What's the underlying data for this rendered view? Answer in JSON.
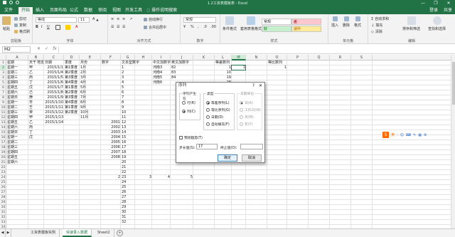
{
  "window": {
    "title": "1.2工资表模板表 - Excel",
    "controls": [
      "—",
      "❐",
      "✕"
    ]
  },
  "ribbon_tabs": [
    "文件",
    "开始",
    "插入",
    "页面布局",
    "公式",
    "数据",
    "审阅",
    "视图",
    "开发工具",
    "帮助"
  ],
  "active_tab": "开始",
  "tell_me": "操作说明搜索",
  "ribbon_right": [
    "登录",
    "共享"
  ],
  "ribbon": {
    "clipboard": {
      "label": "剪贴板",
      "paste": "粘贴",
      "cut": "剪切",
      "copy": "复制",
      "format_painter": "格式刷"
    },
    "font": {
      "label": "字体",
      "family": "等线",
      "size": "11",
      "bold": "B",
      "italic": "I",
      "underline": "U"
    },
    "alignment": {
      "label": "对齐方式",
      "wrap": "自动换行",
      "merge": "合并后居中"
    },
    "number": {
      "label": "数字",
      "format": "常规",
      "percent": "%"
    },
    "styles": {
      "label": "样式",
      "conditional": "条件格式",
      "table": "套用表格格式",
      "normal": "常规",
      "bad": "差",
      "good": "好",
      "neutral": "适中"
    },
    "cells": {
      "label": "单元格",
      "insert": "插入",
      "delete": "删除",
      "format": "格式"
    },
    "editing": {
      "label": "编辑",
      "autosum": "自动求和",
      "fill": "填充",
      "clear": "清除",
      "sort": "排序和筛选",
      "find": "查找和选择"
    }
  },
  "formula_bar": {
    "name_box": "M2",
    "icons": [
      "✕",
      "✓",
      "fx"
    ],
    "content": ""
  },
  "columns": [
    "A",
    "B",
    "C",
    "D",
    "E",
    "F",
    "G",
    "H",
    "I",
    "J",
    "K",
    "L",
    "M",
    "N",
    "O",
    "P",
    "Q",
    "R",
    "S"
  ],
  "selected_column": "M",
  "rows": [
    "1",
    "2",
    "3",
    "4",
    "5",
    "6",
    "7",
    "8",
    "9",
    "10",
    "11",
    "12",
    "13",
    "14",
    "15",
    "16",
    "17",
    "18",
    "19",
    "20",
    "21",
    "22",
    "23",
    "24",
    "25",
    "26",
    "27",
    "28",
    "29",
    "30",
    "31",
    "32",
    "33",
    "34"
  ],
  "selected_row": "2",
  "headers_row1": {
    "A": "星期",
    "B": "天干",
    "B2": "地支",
    "C": "日期",
    "D": "季度",
    "E": "月份",
    "F": "数字",
    "G": "文本型数字",
    "I": "中文加数字",
    "J": "英文加数字",
    "L": "等差数列",
    "O": "等比数列"
  },
  "col_a": [
    "星期一",
    "星期二",
    "星期三",
    "星期四",
    "星期五",
    "星期六",
    "星期日",
    "星期一",
    "星期二",
    "星期三",
    "星期四",
    "星期五",
    "星期六",
    "星期日",
    "星期一",
    "星期二",
    "星期三",
    "星期四",
    "星期五",
    "星期六"
  ],
  "col_b": [
    "甲",
    "乙",
    "丙",
    "丁",
    "戊",
    "己",
    "庚",
    "辛",
    "壬",
    "癸",
    "甲",
    "乙",
    "丙",
    "丁",
    "戊"
  ],
  "col_c": [
    "2015/1/1",
    "2015/1/4",
    "2015/1/5",
    "2015/1/6",
    "2015/1/7",
    "2015/1/8",
    "2015/1/9",
    "2015/1/10",
    "2015/1/11",
    "2015/1/12",
    "2015/1/13",
    "2015/1/14"
  ],
  "col_d": [
    "第1季度",
    "第2季度",
    "第3季度",
    "第4季度",
    "第1季度",
    "第2季度",
    "第3季度",
    "第4季度",
    "第1季度",
    "第2季度"
  ],
  "col_e": [
    "1月",
    "2月",
    "3月",
    "4月",
    "5月",
    "6月",
    "7月",
    "8月",
    "9月",
    "10月",
    "11月"
  ],
  "col_g": [
    "1",
    "2",
    "3",
    "4",
    "5",
    "6",
    "7",
    "8",
    "9",
    "10",
    "11",
    "12",
    "13",
    "14",
    "15",
    "16",
    "17",
    "18",
    "19",
    "20",
    "21",
    "22",
    "23",
    "24",
    "25",
    "26",
    "27",
    "28",
    "29",
    "30",
    "31",
    "32"
  ],
  "col_g_extra": [
    "2001",
    "2002",
    "2003",
    "2004",
    "2005",
    "2006",
    "2007",
    "2008"
  ],
  "col_i": [
    "河南3",
    "河南4",
    "河南5",
    "河南6"
  ],
  "col_j": [
    "82",
    "83",
    "84"
  ],
  "col_l": [
    "1",
    "10",
    "19",
    "28",
    "37",
    "46",
    "55",
    "64",
    "73",
    "82",
    "91",
    "100"
  ],
  "cell_m2": "1",
  "cell_o2": "1",
  "row24": {
    "F": "2",
    "H": "3",
    "I": "4",
    "J": "5"
  },
  "sheets": [
    "工资表模板实例",
    "快速录入数据",
    "Sheet2"
  ],
  "active_sheet": "快速录入数据",
  "dialog": {
    "title": "序列",
    "help": "?",
    "close": "✕",
    "series_in": {
      "label": "序列产生在",
      "rows": "行(R)",
      "cols": "列(C)",
      "selected": "cols"
    },
    "type": {
      "label": "类型",
      "linear": "等差序列(L)",
      "growth": "等比序列(G)",
      "date": "日期(D)",
      "auto": "自动填充(F)",
      "selected": "linear"
    },
    "date_unit": {
      "label": "日期单位",
      "day": "日(A)",
      "weekday": "工作日(W)",
      "month": "月(M)",
      "year": "年(Y)"
    },
    "trend": "预测趋势(T)",
    "step_label": "步长值(S):",
    "step_value": "17",
    "stop_label": "终止值(O):",
    "stop_value": "",
    "ok": "确定",
    "cancel": "取消"
  },
  "ime": {
    "label": "英",
    "icons": [
      "·",
      "☺",
      "⌨",
      "✎",
      "▦",
      "⚙"
    ]
  },
  "colors": {
    "excel_green": "#217346",
    "ribbon_bg": "#f3f3f3",
    "bad_fill": "#ffc7ce",
    "good_fill": "#c6efce",
    "neutral_fill": "#ffeb9c",
    "ime_orange": "#ff6a00"
  }
}
